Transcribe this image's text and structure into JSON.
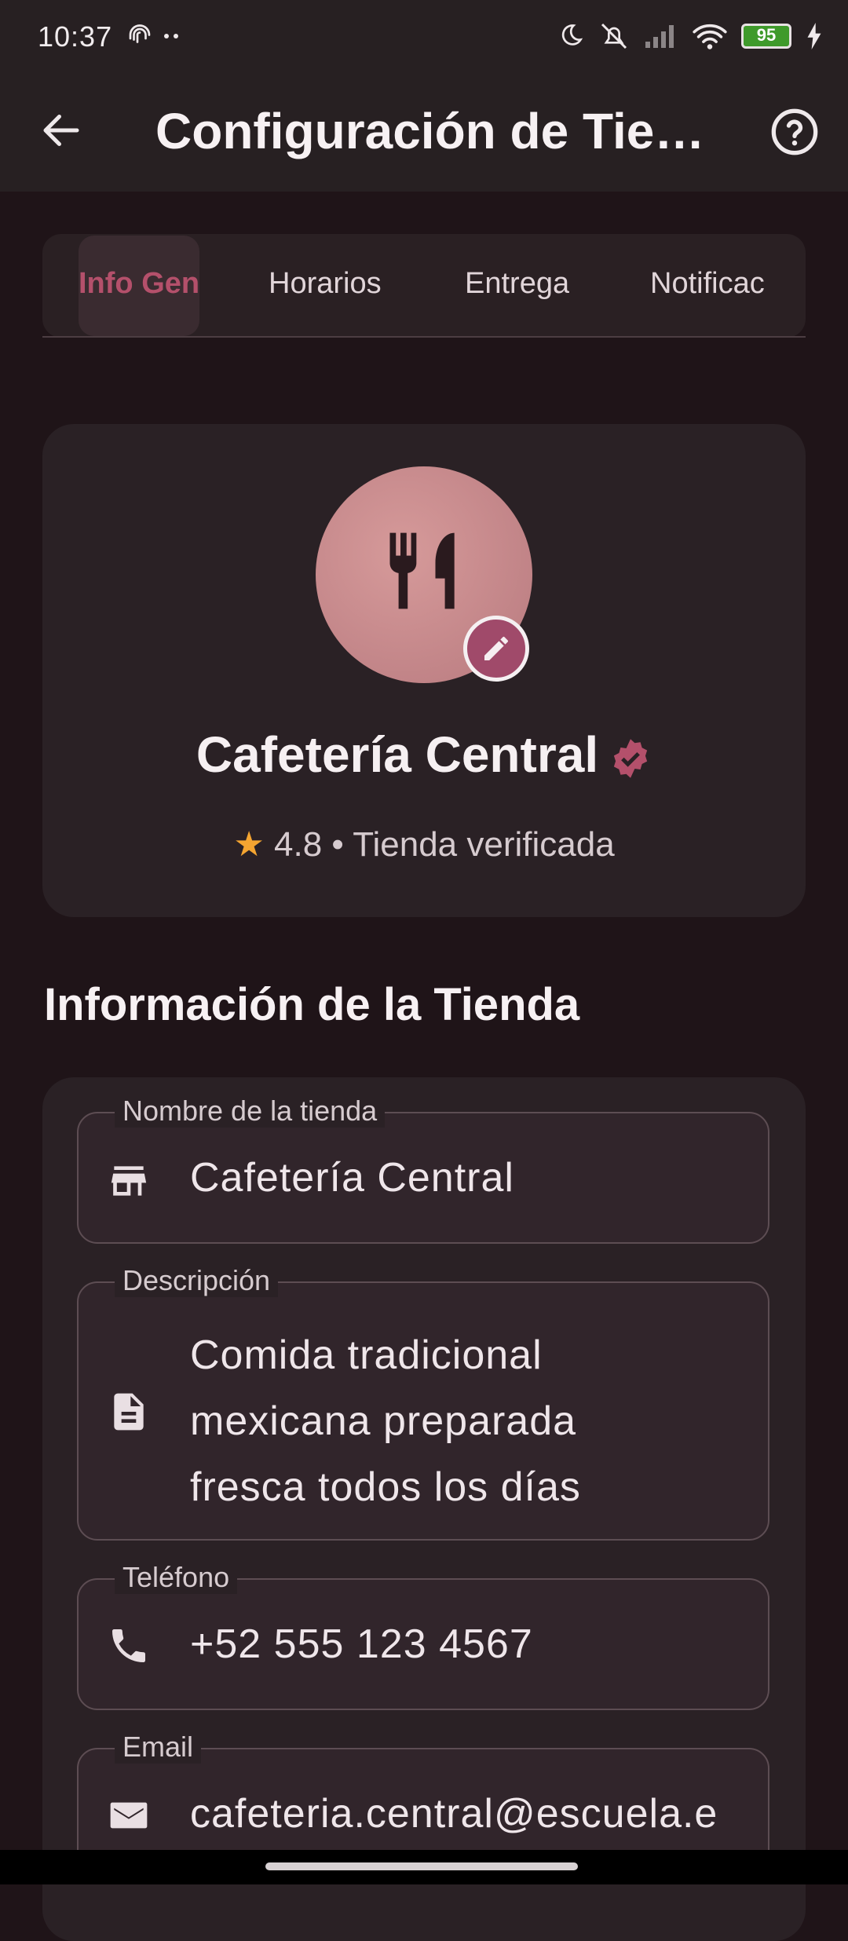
{
  "status_bar": {
    "time": "10:37",
    "battery": "95",
    "icons": [
      "fingerprint-icon",
      "dots-icon",
      "moon-icon",
      "mute-icon",
      "signal-icon",
      "wifi-icon",
      "battery-icon",
      "charging-icon"
    ]
  },
  "app_bar": {
    "title": "Configuración de Tie…",
    "back_icon": "arrow-back-icon",
    "help_icon": "help-circle-icon"
  },
  "tabs": [
    {
      "label": "Info Gen",
      "selected": true
    },
    {
      "label": "Horarios",
      "selected": false
    },
    {
      "label": "Entrega",
      "selected": false
    },
    {
      "label": "Notificac",
      "selected": false
    }
  ],
  "profile": {
    "name": "Cafetería Central",
    "rating": "4.8",
    "separator": "•",
    "status": "Tienda verificada",
    "avatar_icon": "fork-knife-icon",
    "edit_icon": "pencil-icon",
    "verified_icon": "verified-badge-icon"
  },
  "section": {
    "title": "Información de la Tienda"
  },
  "fields": {
    "name": {
      "label": "Nombre de la tienda",
      "value": "Cafetería Central",
      "icon": "store-icon"
    },
    "description": {
      "label": "Descripción",
      "line1": "Comida tradicional",
      "line2": "mexicana preparada",
      "line3": "fresca todos los días",
      "icon": "document-icon"
    },
    "phone": {
      "label": "Teléfono",
      "value": "+52 555 123 4567",
      "icon": "phone-icon"
    },
    "email": {
      "label": "Email",
      "value": "cafeteria.central@escuela.e",
      "icon": "mail-icon"
    }
  },
  "colors": {
    "background": "#1f1418",
    "card": "#2a2125",
    "accent": "#b4506b",
    "star": "#f5a531"
  }
}
